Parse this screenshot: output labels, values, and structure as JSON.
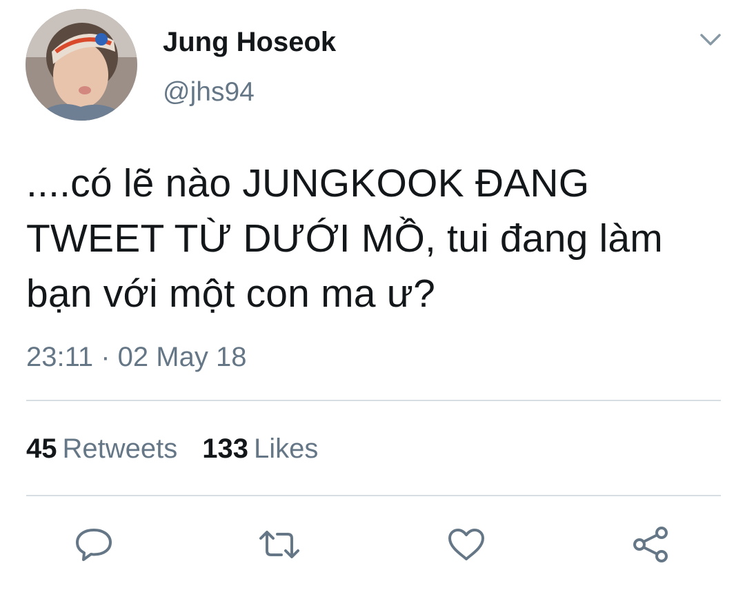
{
  "tweet": {
    "author": {
      "display_name": "Jung Hoseok",
      "handle": "@jhs94"
    },
    "text": "....có lẽ nào JUNGKOOK  ĐANG TWEET TỪ DƯỚI MỒ, tui đang làm bạn với một con ma ư?",
    "timestamp": "23:11 · 02 May 18"
  },
  "stats": {
    "retweets_count": "45",
    "retweets_label": "Retweets",
    "likes_count": "133",
    "likes_label": "Likes"
  },
  "actions": {
    "icons": [
      "reply-icon",
      "retweet-icon",
      "like-icon",
      "share-icon"
    ]
  },
  "colors": {
    "text": "#14171a",
    "secondary_text": "#657786",
    "divider": "#d6dde3",
    "icon": "#657786"
  }
}
